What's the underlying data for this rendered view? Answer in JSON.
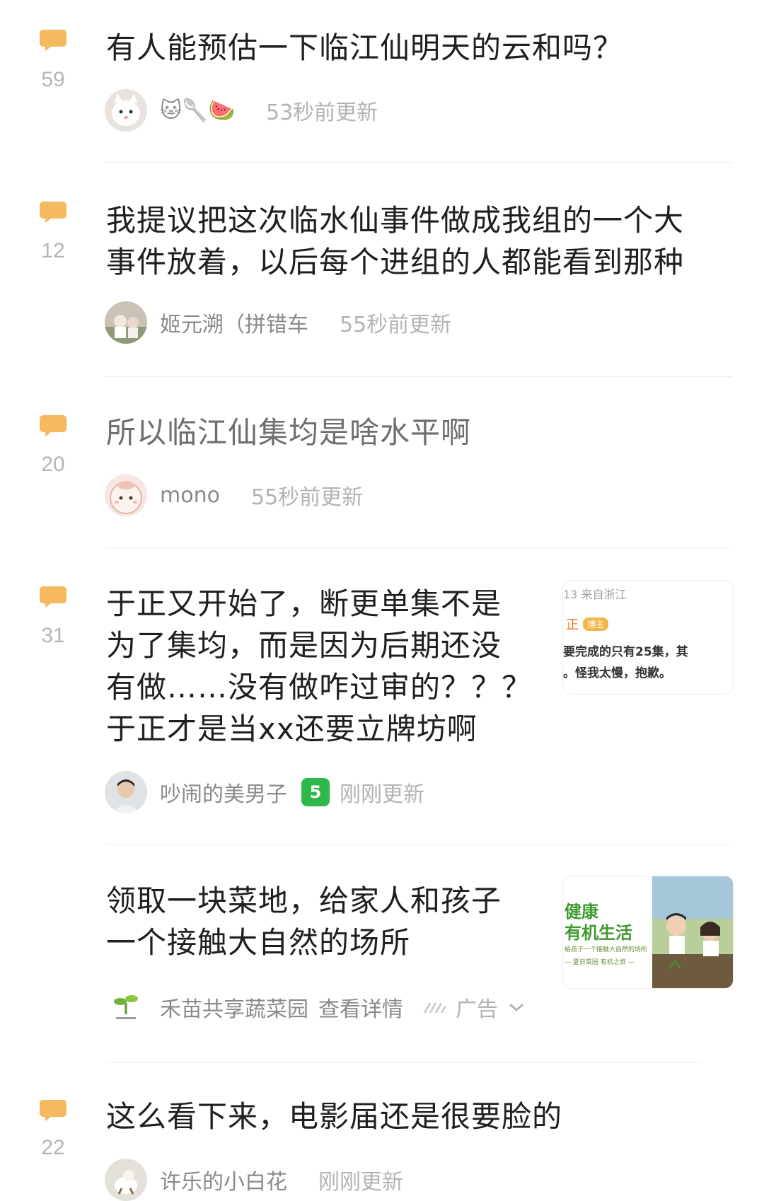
{
  "posts": [
    {
      "reply_count": "59",
      "title": "有人能预估一下临江仙明天的云和吗？",
      "author": "",
      "author_emoji": "🐱🥄🍉",
      "time": "53秒前更新"
    },
    {
      "reply_count": "12",
      "title": "我提议把这次临水仙事件做成我组的一个大\n事件放着，以后每个进组的人都能看到那种",
      "author": "姬元溯（拼错车",
      "time": "55秒前更新"
    },
    {
      "reply_count": "20",
      "title": "所以临江仙集均是啥水平啊",
      "author": "mono",
      "time": "55秒前更新"
    },
    {
      "reply_count": "31",
      "title": "于正又开始了，断更单集不是\n为了集均，而是因为后期还没\n有做……没有做咋过审的？？？\n于正才是当xx还要立牌坊啊",
      "author": "吵闹的美男子",
      "level": "5",
      "time": "刚刚更新",
      "thumb": {
        "line1": "13 来自浙江",
        "line2": "正",
        "tag": "博主",
        "line3": "要完成的只有25集，其",
        "line4": "。怪我太慢，抱歉。"
      }
    },
    {
      "reply_count": "22",
      "title": "这么看下来，电影届还是很要脸的",
      "author": "许乐的小白花",
      "time": "刚刚更新"
    }
  ],
  "ad": {
    "title": "领取一块菜地，给家人和孩子\n一个接触大自然的场所",
    "advertiser": "禾苗共享蔬菜园",
    "details_label": "查看详情",
    "ad_label": "广告",
    "thumb": {
      "line1": "健康",
      "line2": "有机生活",
      "line3": "给孩子一个接触大自然的场所",
      "line4": "— 夏日菜园 有机之旅 —"
    }
  },
  "colors": {
    "bubble": "#f5b95f",
    "text": "#1f1f1f",
    "muted": "#b3b3b3",
    "level_badge": "#2fb84a"
  }
}
